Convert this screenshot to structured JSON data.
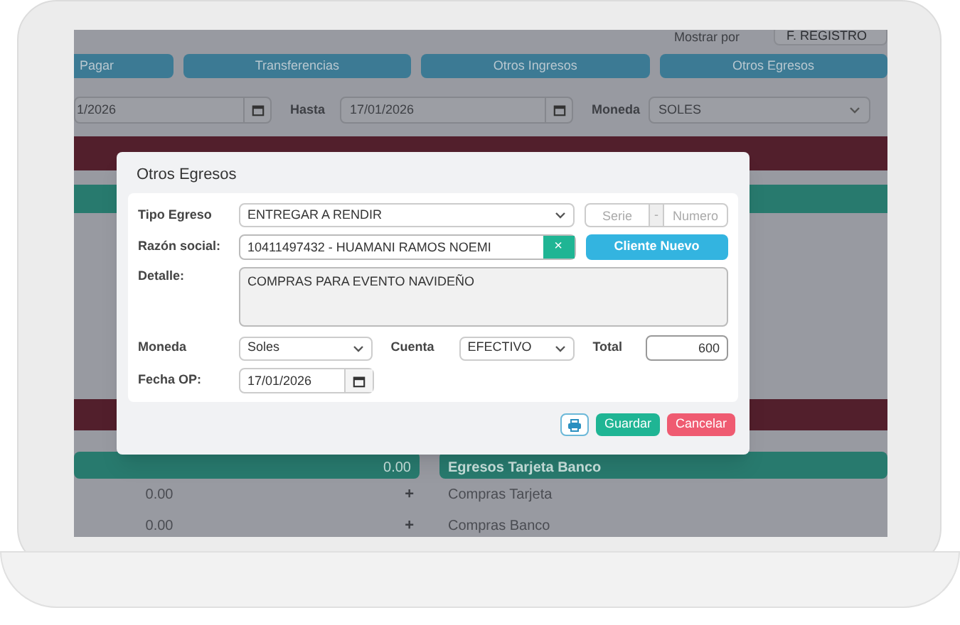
{
  "background": {
    "show_by": {
      "label": "Mostrar por",
      "value": "F. REGISTRO"
    },
    "tab_buttons": [
      "Pagar",
      "Transferencias",
      "Otros Ingresos",
      "Otros Egresos"
    ],
    "filters": {
      "from_date": "1/2026",
      "to_label": "Hasta",
      "to_date": "17/01/2026",
      "currency_label": "Moneda",
      "currency": "SOLES"
    },
    "left_rows": [
      {
        "value": "0.00",
        "kind": "header"
      },
      {
        "value": "0.00",
        "kind": "row",
        "action": "+"
      },
      {
        "value": "0.00",
        "kind": "row",
        "action": "+"
      }
    ],
    "right_rows": [
      {
        "label": "Egresos Tarjeta Banco",
        "kind": "header"
      },
      {
        "label": "Compras Tarjeta",
        "kind": "row"
      },
      {
        "label": "Compras Banco",
        "kind": "row"
      }
    ]
  },
  "dialog": {
    "title": "Otros Egresos",
    "tipo_egreso": {
      "label": "Tipo Egreso",
      "value": "ENTREGAR A RENDIR",
      "serie_placeholder": "Serie",
      "separator": "-",
      "numero_placeholder": "Numero"
    },
    "razon_social": {
      "label": "Razón social:",
      "value": "10411497432 - HUAMANI RAMOS NOEMI",
      "clear": "×",
      "new_button": "Cliente Nuevo"
    },
    "detalle": {
      "label": "Detalle:",
      "value": "COMPRAS PARA EVENTO NAVIDEÑO"
    },
    "moneda": {
      "label": "Moneda",
      "value": "Soles"
    },
    "cuenta": {
      "label": "Cuenta",
      "value": "EFECTIVO"
    },
    "total": {
      "label": "Total",
      "value": "600"
    },
    "fecha": {
      "label": "Fecha OP:",
      "value": "17/01/2026"
    },
    "buttons": [
      "Guardar",
      "Cancelar"
    ]
  }
}
